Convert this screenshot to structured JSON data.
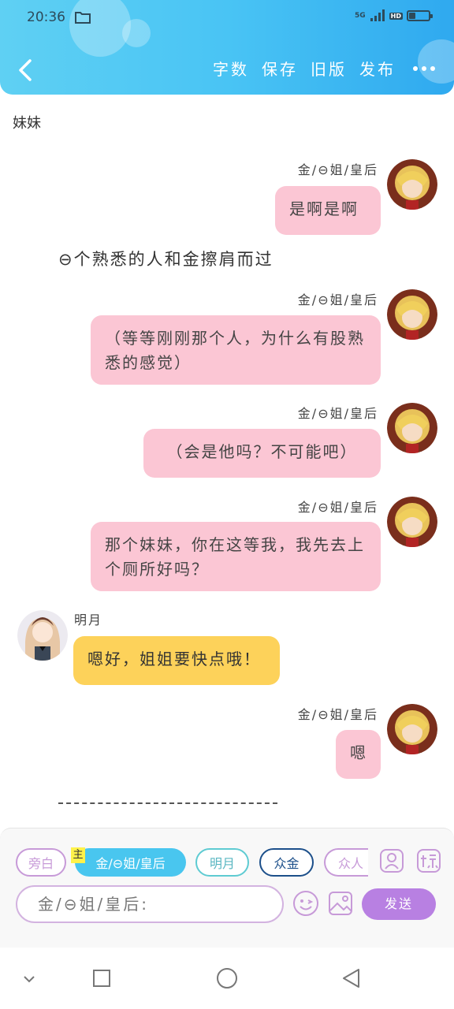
{
  "status_bar": {
    "time": "20:36",
    "network": "5G",
    "hd": "HD",
    "battery_level": 0.35,
    "icons": [
      "folder-icon",
      "signal-icon",
      "battery-icon"
    ]
  },
  "header": {
    "back_icon": "chevron-left-icon",
    "actions": [
      "字数",
      "保存",
      "旧版",
      "发布"
    ],
    "more_icon": "more-dots-icon",
    "accent": "#49c4f4"
  },
  "conversation": {
    "title": "妹妹",
    "messages": [
      {
        "side": "right",
        "sender": "金/⊖姐/皇后",
        "text": "是啊是啊"
      },
      {
        "side": "narration",
        "text": "⊖个熟悉的人和金擦肩而过"
      },
      {
        "side": "right",
        "sender": "金/⊖姐/皇后",
        "text": "（等等刚刚那个人，为什么有股熟悉的感觉）"
      },
      {
        "side": "right",
        "sender": "金/⊖姐/皇后",
        "text": "（会是他吗？不可能吧）"
      },
      {
        "side": "right",
        "sender": "金/⊖姐/皇后",
        "text": "那个妹妹，你在这等我，我先去上个厕所好吗？"
      },
      {
        "side": "left",
        "sender": "明月",
        "text": "嗯好，姐姐要快点哦！"
      },
      {
        "side": "right",
        "sender": "金/⊖姐/皇后",
        "text": "嗯"
      }
    ],
    "colors": {
      "pink_bubble": "#fbc6d4",
      "yellow_bubble": "#fdd25a"
    }
  },
  "input_panel": {
    "main_tag": "主",
    "roles": [
      {
        "label": "旁白",
        "selected": false
      },
      {
        "label": "金/⊖姐/皇后",
        "selected": true
      },
      {
        "label": "明月",
        "selected": false
      },
      {
        "label": "众金",
        "selected": false
      },
      {
        "label": "众人",
        "selected": false
      }
    ],
    "role_icons": [
      "person-icon",
      "label-icon"
    ],
    "input_value": "金/⊖姐/皇后:",
    "tool_icons": [
      "emoji-icon",
      "image-icon"
    ],
    "send_label": "发送",
    "send_color": "#b880e2"
  },
  "system_nav": [
    "chevron-down-icon",
    "square-icon",
    "circle-icon",
    "triangle-back-icon"
  ]
}
